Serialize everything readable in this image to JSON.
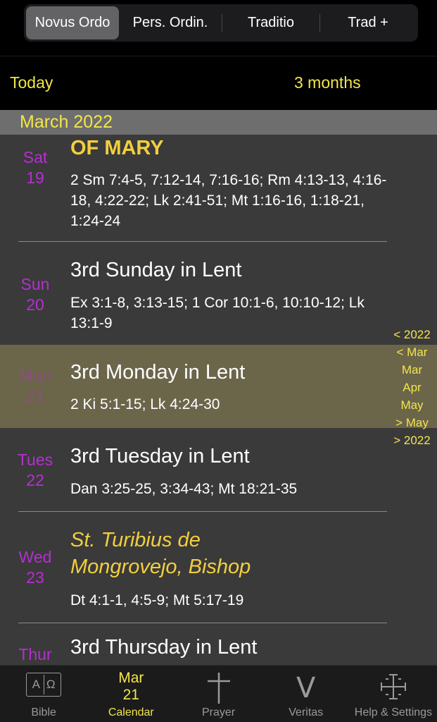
{
  "segments": [
    "Novus Ordo",
    "Pers. Ordin.",
    "Traditio",
    "Trad +"
  ],
  "toolbar": {
    "today": "Today",
    "range": "3 months"
  },
  "month_header": "March 2022",
  "days": [
    {
      "dow": "Sat",
      "day": "19",
      "title": "OF MARY",
      "readings": "2 Sm 7:4-5, 7:12-14, 7:16-16; Rm 4:13-13, 4:16-18, 4:22-22; Lk 2:41-51; Mt 1:16-16, 1:18-21, 1:24-24"
    },
    {
      "dow": "Sun",
      "day": "20",
      "title": "3rd Sunday in Lent",
      "readings": "Ex 3:1-8, 3:13-15; 1 Cor 10:1-6, 10:10-12; Lk 13:1-9"
    },
    {
      "dow": "Mon",
      "day": "21",
      "title": "3rd Monday in Lent",
      "readings": "2 Ki 5:1-15; Lk 4:24-30"
    },
    {
      "dow": "Tues",
      "day": "22",
      "title": "3rd Tuesday in Lent",
      "readings": "Dan 3:25-25, 3:34-43; Mt 18:21-35"
    },
    {
      "dow": "Wed",
      "day": "23",
      "title": "St. Turibius de Mongrovejo, Bishop",
      "readings": "Dt 4:1-1, 4:5-9; Mt 5:17-19"
    },
    {
      "dow": "Thur",
      "day": "",
      "title": "3rd Thursday in Lent",
      "readings": ""
    }
  ],
  "side_index": [
    "< 2022",
    "< Mar",
    "Mar",
    "Apr",
    "May",
    "> May",
    "> 2022"
  ],
  "tabs": {
    "bible": "Bible",
    "bible_icon_text": "AΩ",
    "calendar_month": "Mar",
    "calendar_day": "21",
    "calendar": "Calendar",
    "prayer": "Prayer",
    "veritas": "Veritas",
    "veritas_icon_text": "V",
    "help": "Help & Settings"
  },
  "colors": {
    "accent": "#f2e64a",
    "weekday": "#b52fd0",
    "feast": "#f2cf3d",
    "highlight": "#6b654a"
  }
}
